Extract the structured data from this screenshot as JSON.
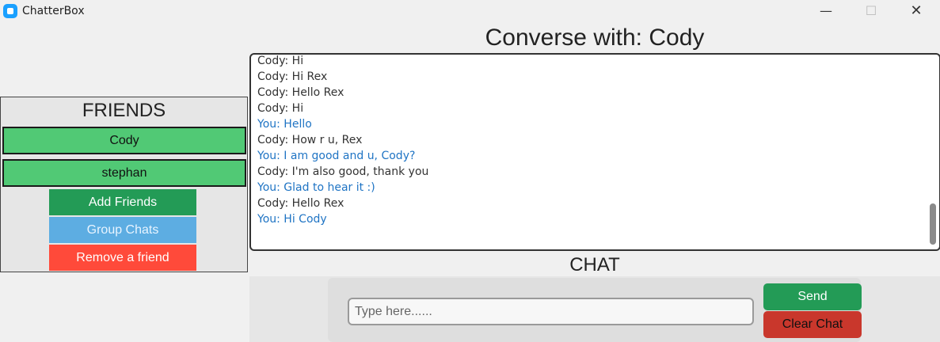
{
  "window": {
    "title": "ChatterBox",
    "controls": {
      "minimize": "—",
      "maximize": "☐",
      "close": "✕"
    }
  },
  "sidebar": {
    "title": "FRIENDS",
    "friends": [
      "Cody",
      "stephan"
    ],
    "buttons": {
      "add": "Add Friends",
      "group": "Group Chats",
      "remove": "Remove a friend"
    }
  },
  "conversation": {
    "title": "Converse with: Cody",
    "messages": [
      {
        "text": "Cody: Hi",
        "from": "friend"
      },
      {
        "text": "Cody: Hi Rex",
        "from": "friend"
      },
      {
        "text": "Cody: Hello Rex",
        "from": "friend"
      },
      {
        "text": "Cody: Hi",
        "from": "friend"
      },
      {
        "text": "You: Hello",
        "from": "you"
      },
      {
        "text": "Cody: How r u, Rex",
        "from": "friend"
      },
      {
        "text": "You: I am good and u, Cody?",
        "from": "you"
      },
      {
        "text": "Cody: I'm also good, thank you",
        "from": "friend"
      },
      {
        "text": "You: Glad to hear it :)",
        "from": "you"
      },
      {
        "text": "Cody: Hello Rex",
        "from": "friend"
      },
      {
        "text": "You: Hi Cody",
        "from": "you"
      }
    ]
  },
  "chat": {
    "label": "CHAT",
    "input_placeholder": "Type here......",
    "input_value": "",
    "send_label": "Send",
    "clear_label": "Clear Chat"
  },
  "colors": {
    "friend_green": "#51c975",
    "add_green": "#239b56",
    "group_blue": "#5dade2",
    "remove_red": "#ff4a3a",
    "clear_red": "#c9372c",
    "you_text": "#1f74c4"
  }
}
